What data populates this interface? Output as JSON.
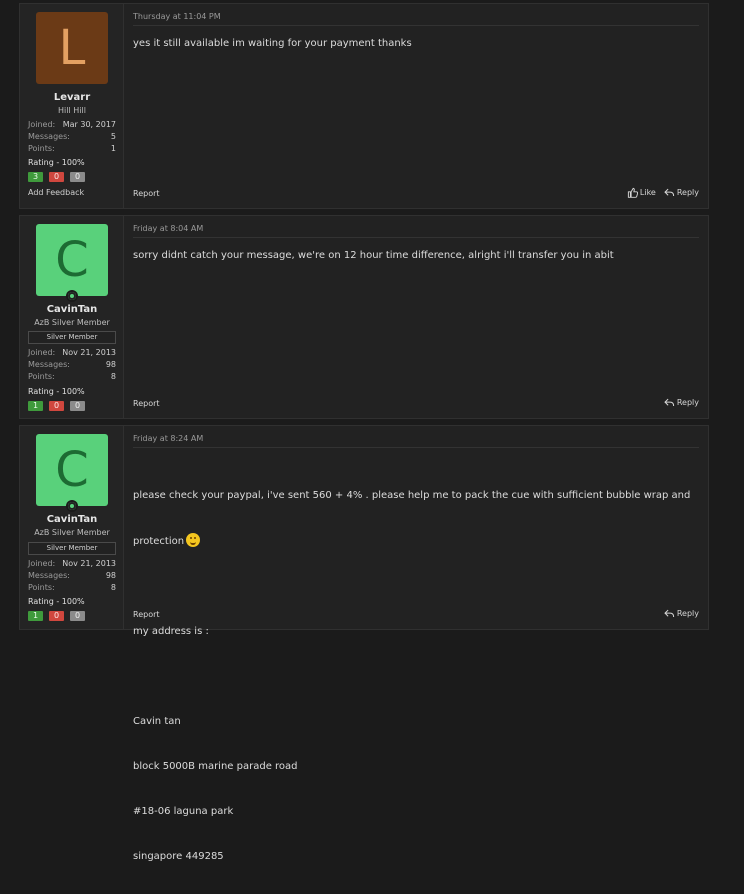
{
  "posts": [
    {
      "avatar_letter": "L",
      "username": "Levarr",
      "user_title": "Hill Hill",
      "joined_label": "Joined:",
      "joined": "Mar 30, 2017",
      "messages_label": "Messages:",
      "messages": "5",
      "points_label": "Points:",
      "points": "1",
      "rating": "Rating - 100%",
      "fb_pos": "3",
      "fb_neg": "0",
      "fb_neu": "0",
      "add_feedback": "Add Feedback",
      "date": "Thursday at 11:04 PM",
      "message": "yes it still available im waiting for your payment thanks",
      "report": "Report",
      "like": "Like",
      "reply": "Reply"
    },
    {
      "avatar_letter": "C",
      "username": "CavinTan",
      "user_title": "AzB Silver Member",
      "banner": "Silver Member",
      "joined_label": "Joined:",
      "joined": "Nov 21, 2013",
      "messages_label": "Messages:",
      "messages": "98",
      "points_label": "Points:",
      "points": "8",
      "rating": "Rating - 100%",
      "fb_pos": "1",
      "fb_neg": "0",
      "fb_neu": "0",
      "date": "Friday at 8:04 AM",
      "message": "sorry didnt catch your message, we're on 12 hour time difference, alright i'll transfer you in abit",
      "report": "Report",
      "reply": "Reply"
    },
    {
      "avatar_letter": "C",
      "username": "CavinTan",
      "user_title": "AzB Silver Member",
      "banner": "Silver Member",
      "joined_label": "Joined:",
      "joined": "Nov 21, 2013",
      "messages_label": "Messages:",
      "messages": "98",
      "points_label": "Points:",
      "points": "8",
      "rating": "Rating - 100%",
      "fb_pos": "1",
      "fb_neg": "0",
      "fb_neu": "0",
      "date": "Friday at 8:24 AM",
      "message_line1": "please check your paypal, i've sent 560 + 4% . please help me to pack the cue with sufficient bubble wrap and",
      "message_line2": "protection",
      "emoji": "smile-emoji",
      "address_intro": "my address is :",
      "address_lines": [
        "Cavin tan",
        "block 5000B marine parade road",
        "#18-06 laguna park",
        "singapore 449285"
      ],
      "report": "Report",
      "reply": "Reply"
    }
  ]
}
